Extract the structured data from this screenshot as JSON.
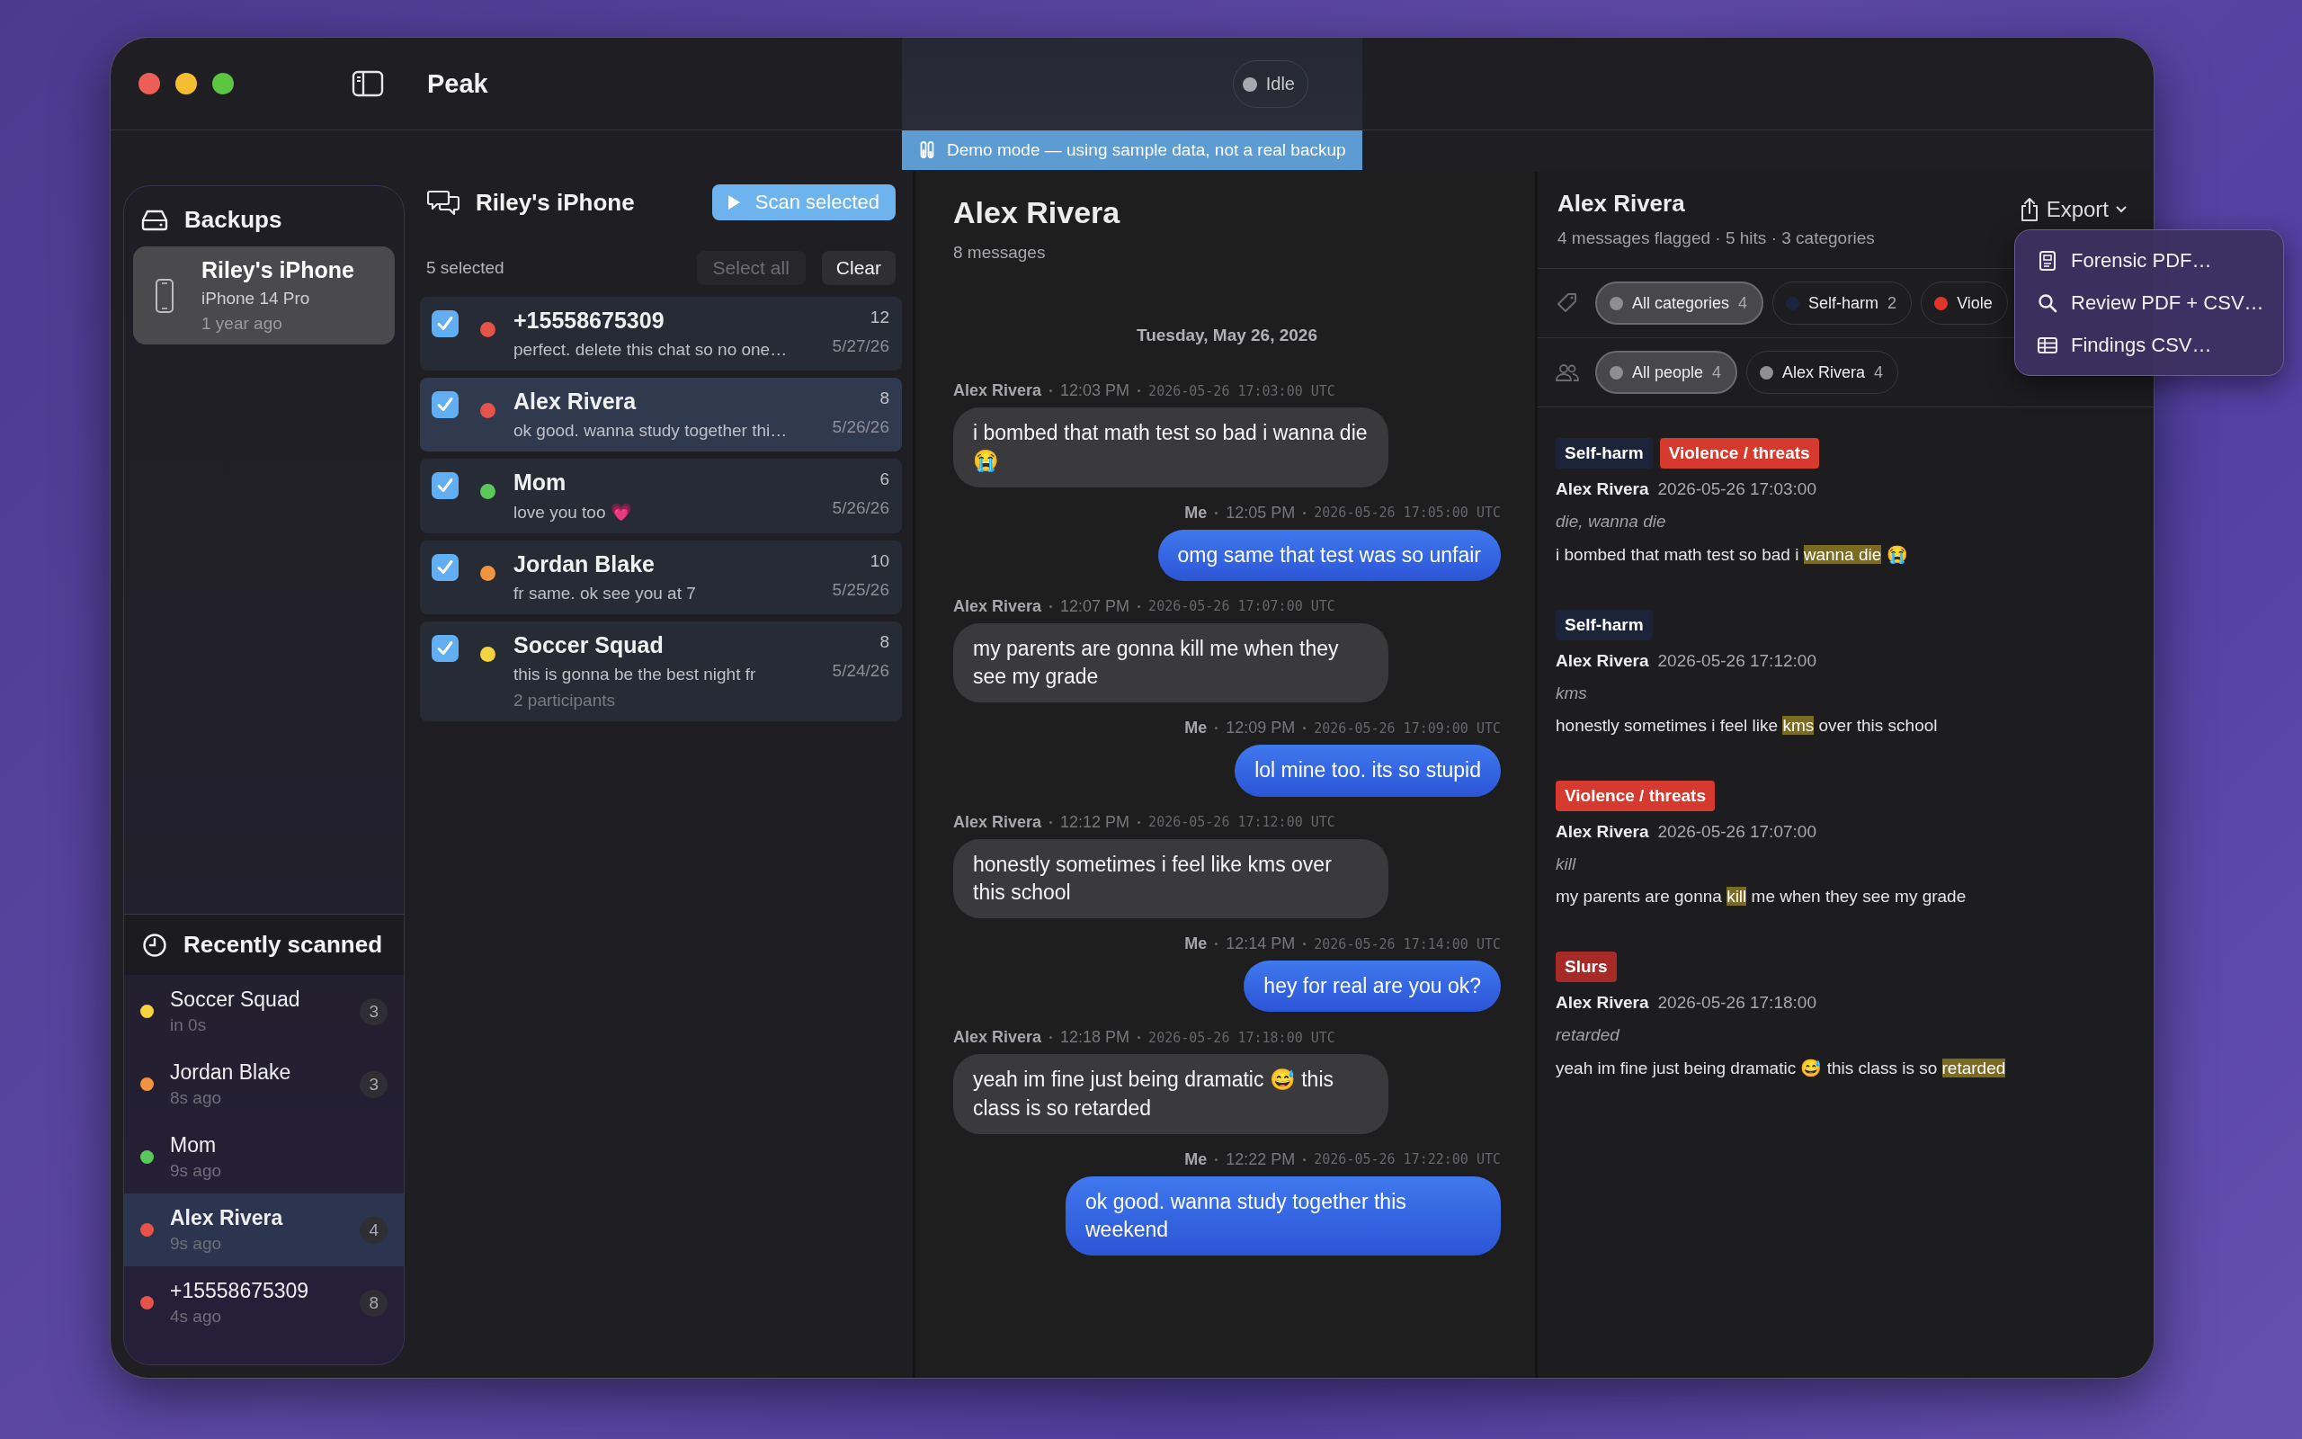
{
  "window": {
    "title": "Peak",
    "status": "Idle"
  },
  "banner": "Demo mode — using sample data, not a real backup",
  "sidebar": {
    "title": "Backups",
    "devices": [
      {
        "name": "Riley's iPhone",
        "model": "iPhone 14 Pro",
        "age": "1 year ago",
        "selected": true
      }
    ],
    "recent_title": "Recently scanned",
    "recent": [
      {
        "name": "Soccer Squad",
        "time": "in 0s",
        "count": "3",
        "color": "#f5d33f",
        "selected": false
      },
      {
        "name": "Jordan Blake",
        "time": "8s ago",
        "count": "3",
        "color": "#f0953f",
        "selected": false
      },
      {
        "name": "Mom",
        "time": "9s ago",
        "color": "#5ac85a",
        "selected": false
      },
      {
        "name": "Alex Rivera",
        "time": "9s ago",
        "count": "4",
        "color": "#e5534b",
        "selected": true
      },
      {
        "name": "+15558675309",
        "time": "4s ago",
        "count": "8",
        "color": "#e5534b",
        "selected": false
      }
    ]
  },
  "conversations": {
    "title": "Riley's iPhone",
    "scan_button": "Scan selected",
    "selection_count": "5 selected",
    "select_all": {
      "label": "Select all",
      "disabled": true
    },
    "clear": {
      "label": "Clear",
      "disabled": false
    },
    "items": [
      {
        "name": "+15558675309",
        "preview": "perfect. delete this chat so no one…",
        "count": "12",
        "date": "5/27/26",
        "color": "#e5534b",
        "checked": true,
        "selected": false
      },
      {
        "name": "Alex Rivera",
        "preview": "ok good. wanna study together thi…",
        "count": "8",
        "date": "5/26/26",
        "color": "#e5534b",
        "checked": true,
        "selected": true
      },
      {
        "name": "Mom",
        "preview": "love you too 💗",
        "count": "6",
        "date": "5/26/26",
        "color": "#5ac85a",
        "checked": true,
        "selected": false
      },
      {
        "name": "Jordan Blake",
        "preview": "fr same. ok see you at 7",
        "count": "10",
        "date": "5/25/26",
        "color": "#f0953f",
        "checked": true,
        "selected": false
      },
      {
        "name": "Soccer Squad",
        "preview": "this is gonna be the best night fr",
        "participants": "2 participants",
        "count": "8",
        "date": "5/24/26",
        "color": "#f5d33f",
        "checked": true,
        "selected": false
      }
    ]
  },
  "chat": {
    "title": "Alex Rivera",
    "subtitle": "8 messages",
    "date": "Tuesday, May 26, 2026",
    "messages": [
      {
        "sender": "Alex Rivera",
        "time": "12:03 PM",
        "utc": "2026-05-26 17:03:00 UTC",
        "text": "i bombed that math test so bad i wanna die 😭",
        "outgoing": false
      },
      {
        "sender": "Me",
        "time": "12:05 PM",
        "utc": "2026-05-26 17:05:00 UTC",
        "text": "omg same that test was so unfair",
        "outgoing": true
      },
      {
        "sender": "Alex Rivera",
        "time": "12:07 PM",
        "utc": "2026-05-26 17:07:00 UTC",
        "text": "my parents are gonna kill me when they see my grade",
        "outgoing": false
      },
      {
        "sender": "Me",
        "time": "12:09 PM",
        "utc": "2026-05-26 17:09:00 UTC",
        "text": "lol mine too. its so stupid",
        "outgoing": true
      },
      {
        "sender": "Alex Rivera",
        "time": "12:12 PM",
        "utc": "2026-05-26 17:12:00 UTC",
        "text": "honestly sometimes i feel like kms over this school",
        "outgoing": false
      },
      {
        "sender": "Me",
        "time": "12:14 PM",
        "utc": "2026-05-26 17:14:00 UTC",
        "text": "hey for real are you ok?",
        "outgoing": true
      },
      {
        "sender": "Alex Rivera",
        "time": "12:18 PM",
        "utc": "2026-05-26 17:18:00 UTC",
        "text": "yeah im fine just being dramatic 😅 this class is so retarded",
        "outgoing": false
      },
      {
        "sender": "Me",
        "time": "12:22 PM",
        "utc": "2026-05-26 17:22:00 UTC",
        "text": "ok good. wanna study together this weekend",
        "outgoing": true
      }
    ]
  },
  "findings": {
    "title": "Alex Rivera",
    "summary": "4 messages flagged · 5 hits · 3 categories",
    "export": "Export",
    "export_menu": [
      {
        "label": "Forensic PDF…",
        "kind": "document"
      },
      {
        "label": "Review PDF + CSV…",
        "kind": "search"
      },
      {
        "label": "Findings CSV…",
        "kind": "table"
      }
    ],
    "category_filters": [
      {
        "label": "All categories",
        "count": "4",
        "color": "#8e8e93",
        "selected": true
      },
      {
        "label": "Self-harm",
        "count": "2",
        "color": "#1b2540",
        "selected": false
      },
      {
        "label": "Viole",
        "color": "#e0352b",
        "selected": false
      }
    ],
    "people_filters": [
      {
        "label": "All people",
        "count": "4",
        "color": "#8e8e93",
        "selected": true
      },
      {
        "label": "Alex Rivera",
        "count": "4",
        "color": "#8e8e93",
        "selected": false
      }
    ],
    "items": [
      {
        "tags": [
          {
            "label": "Self-harm",
            "color": "#1b2438"
          },
          {
            "label": "Violence / threats",
            "color": "#d63a2f"
          }
        ],
        "sender": "Alex Rivera",
        "timestamp": "2026-05-26 17:03:00",
        "terms": "die, wanna die",
        "segments": [
          {
            "text": "i bombed that math test so bad i ",
            "hit": false
          },
          {
            "text": "wanna die",
            "hit": true
          },
          {
            "text": " 😭",
            "hit": false
          }
        ]
      },
      {
        "tags": [
          {
            "label": "Self-harm",
            "color": "#1b2438"
          }
        ],
        "sender": "Alex Rivera",
        "timestamp": "2026-05-26 17:12:00",
        "terms": "kms",
        "segments": [
          {
            "text": "honestly sometimes i feel like ",
            "hit": false
          },
          {
            "text": "kms",
            "hit": true
          },
          {
            "text": " over this school",
            "hit": false
          }
        ]
      },
      {
        "tags": [
          {
            "label": "Violence / threats",
            "color": "#d63a2f"
          }
        ],
        "sender": "Alex Rivera",
        "timestamp": "2026-05-26 17:07:00",
        "terms": "kill",
        "segments": [
          {
            "text": "my parents are gonna ",
            "hit": false
          },
          {
            "text": "kill",
            "hit": true
          },
          {
            "text": " me when they see my grade",
            "hit": false
          }
        ]
      },
      {
        "tags": [
          {
            "label": "Slurs",
            "color": "#a52a28"
          }
        ],
        "sender": "Alex Rivera",
        "timestamp": "2026-05-26 17:18:00",
        "terms": "retarded",
        "segments": [
          {
            "text": "yeah im fine just being dramatic 😅 this class is so ",
            "hit": false
          },
          {
            "text": "retarded",
            "hit": true
          }
        ]
      }
    ]
  }
}
